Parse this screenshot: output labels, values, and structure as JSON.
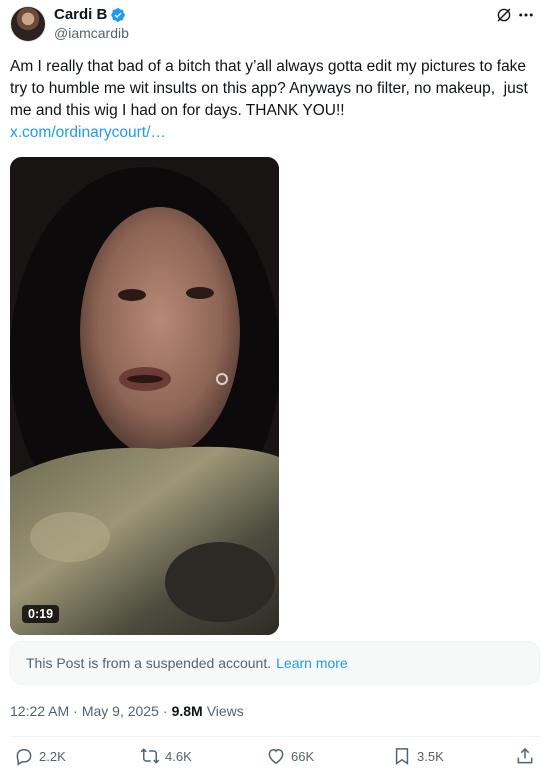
{
  "user": {
    "display_name": "Cardi B",
    "handle": "@iamcardib"
  },
  "post": {
    "text": "Am I really that bad of a bitch that y’all always gotta edit my pictures to fake try to humble me wit insults on this app? Anyways no filter, no makeup,  just me and this wig I had on for days. THANK YOU!!",
    "link": "x.com/ordinarycourt/…",
    "video_duration": "0:19",
    "notice": "This Post is from a suspended account.",
    "notice_link": "Learn more",
    "time": "12:22 AM",
    "separator": "·",
    "date": "May 9, 2025",
    "views_count": "9.8M",
    "views_label": "Views"
  },
  "actions": {
    "replies": "2.2K",
    "reposts": "4.6K",
    "likes": "66K",
    "bookmarks": "3.5K"
  },
  "colors": {
    "accent": "#1d9bf0",
    "secondary_text": "#536471",
    "primary_text": "#0f1419"
  },
  "icons": [
    "verified-badge-icon",
    "grok-icon",
    "more-icon",
    "reply-icon",
    "repost-icon",
    "like-icon",
    "bookmark-icon",
    "share-icon"
  ]
}
